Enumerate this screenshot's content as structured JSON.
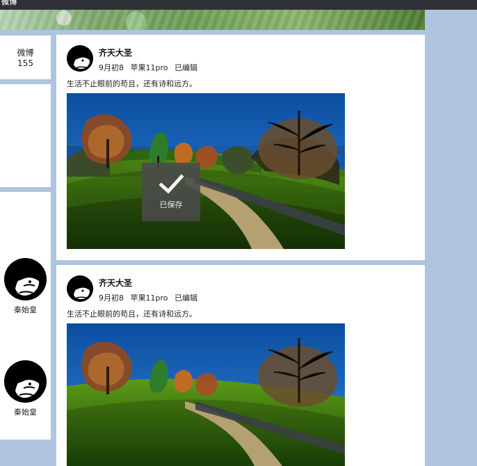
{
  "window": {
    "title": "微博"
  },
  "sidebar": {
    "stats_label": "微博",
    "stats_count": "155",
    "people": [
      {
        "name": "秦始皇",
        "avatar_icon": "anime-avatar-icon"
      },
      {
        "name": "秦始皇",
        "avatar_icon": "anime-avatar-icon"
      }
    ]
  },
  "posts": [
    {
      "author": "齐天大圣",
      "date": "9月初8",
      "device": "苹果11pro",
      "edited": "已编辑",
      "content": "生活不止眼前的苟且，还有诗和远方。",
      "image_icon": "landscape-photo"
    },
    {
      "author": "齐天大圣",
      "date": "9月初8",
      "device": "苹果11pro",
      "edited": "已编辑",
      "content": "生活不止眼前的苟且，还有诗和远方。",
      "image_icon": "landscape-photo"
    }
  ],
  "toast": {
    "text": "已保存",
    "icon": "check-icon"
  },
  "colors": {
    "page_bg": "#afc4de",
    "topbar": "#2f3136",
    "card_bg": "#ffffff"
  }
}
